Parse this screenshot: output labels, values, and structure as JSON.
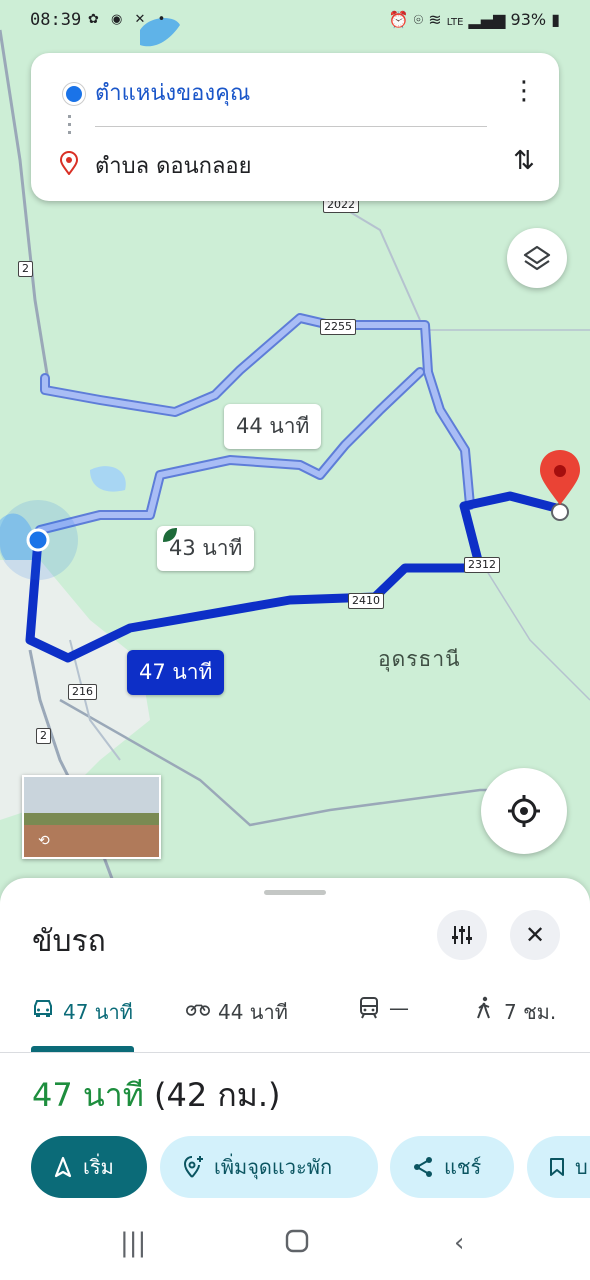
{
  "status_bar": {
    "time": "08:39",
    "left_icons": [
      "lotus-icon",
      "messenger-icon",
      "tool-icon",
      "dot-icon"
    ],
    "right_icons": [
      "alarm-icon",
      "location-icon",
      "wifi-icon",
      "volte-icon",
      "signal-icon"
    ],
    "battery": "93%"
  },
  "directions": {
    "origin": "ตำแหน่งของคุณ",
    "destination": "ตำบล ดอนกลอย"
  },
  "map": {
    "route_labels": {
      "primary": "47 นาที",
      "alt1": "44 นาที",
      "alt2": "43 นาที"
    },
    "road_shields": [
      "2022",
      "2",
      "2255",
      "2312",
      "2410",
      "216",
      "2",
      "2"
    ],
    "place_label": "อุดรธานี",
    "colors": {
      "route_primary": "#0d2fc7",
      "route_alt": "#a9bdf5",
      "map_bg": "#cdeed6",
      "pin": "#ea4335"
    }
  },
  "sheet": {
    "title": "ขับรถ",
    "modes": [
      {
        "icon": "car-icon",
        "label": "47 นาที",
        "selected": true
      },
      {
        "icon": "motorcycle-icon",
        "label": "44 นาที"
      },
      {
        "icon": "train-icon",
        "label": "—"
      },
      {
        "icon": "walk-icon",
        "label": "7 ชม."
      }
    ],
    "summary": {
      "duration": "47 นาที",
      "distance": "(42 กม.)"
    },
    "actions": {
      "start": "เริ่ม",
      "add_stop": "เพิ่มจุดแวะพัก",
      "share": "แชร์",
      "save": "บ"
    }
  }
}
